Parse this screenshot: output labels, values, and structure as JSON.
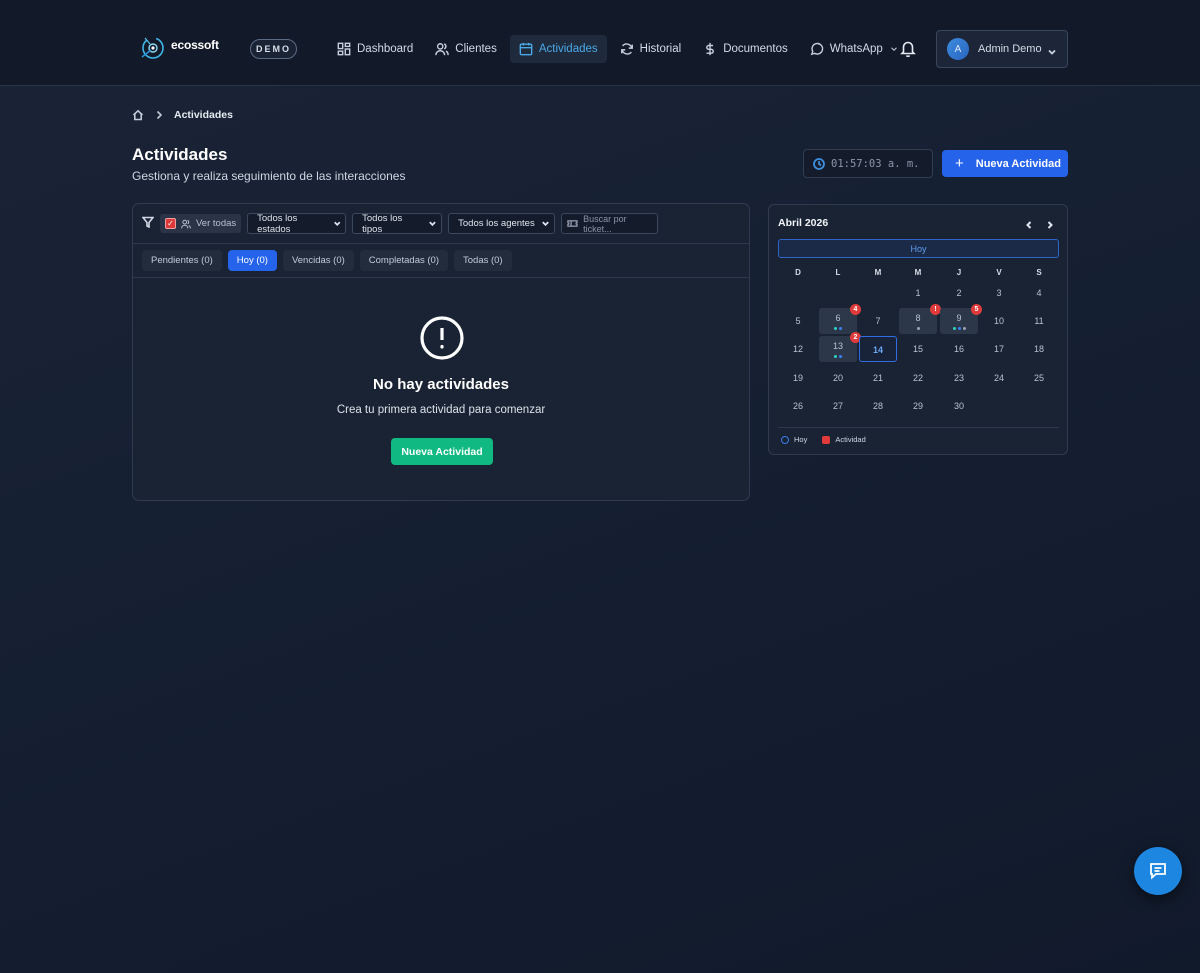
{
  "brand": {
    "logo_text": "ecossoft",
    "badge": "DEMO"
  },
  "nav": {
    "items": [
      {
        "label": "Dashboard",
        "icon": "dashboard-icon",
        "active": false
      },
      {
        "label": "Clientes",
        "icon": "users-icon",
        "active": false
      },
      {
        "label": "Actividades",
        "icon": "calendar-icon",
        "active": true
      },
      {
        "label": "Historial",
        "icon": "refresh-icon",
        "active": false
      },
      {
        "label": "Documentos",
        "icon": "dollar-icon",
        "active": false
      },
      {
        "label": "WhatsApp",
        "icon": "chat-bubble-icon",
        "active": false
      }
    ]
  },
  "user": {
    "avatar_letter": "A",
    "name": "Admin Demo"
  },
  "breadcrumb": {
    "current": "Actividades"
  },
  "page": {
    "title": "Actividades",
    "subtitle": "Gestiona y realiza seguimiento de las interacciones",
    "clock": "01:57:03 a. m.",
    "new_button": "Nueva Actividad"
  },
  "filters": {
    "ver_todas": "Ver todas",
    "ver_todas_checked": true,
    "estados": "Todos los estados",
    "tipos": "Todos los tipos",
    "agentes": "Todos los agentes",
    "ticket_placeholder": "Buscar por ticket..."
  },
  "tabs": [
    {
      "label": "Pendientes (0)",
      "active": false
    },
    {
      "label": "Hoy (0)",
      "active": true
    },
    {
      "label": "Vencidas (0)",
      "active": false
    },
    {
      "label": "Completadas (0)",
      "active": false
    },
    {
      "label": "Todas (0)",
      "active": false
    }
  ],
  "empty_state": {
    "title": "No hay actividades",
    "message": "Crea tu primera actividad para comenzar",
    "button": "Nueva Actividad"
  },
  "calendar": {
    "month_label": "Abril 2026",
    "today_button": "Hoy",
    "weekdays": [
      "D",
      "L",
      "M",
      "M",
      "J",
      "V",
      "S"
    ],
    "first_weekday_index": 3,
    "days_in_month": 30,
    "today": 14,
    "activity_days": {
      "6": {
        "badge": "4",
        "dots": [
          "#2dd4bf",
          "#3b82f6"
        ]
      },
      "8": {
        "badge": "!",
        "dots": [
          "#9aa4b4"
        ]
      },
      "9": {
        "badge": "5",
        "dots": [
          "#2dd4bf",
          "#3b82f6",
          "#9aa4b4"
        ]
      },
      "13": {
        "badge": "2",
        "dots": [
          "#2dd4bf",
          "#3b82f6"
        ]
      }
    },
    "legend": {
      "today": "Hoy",
      "activity": "Actividad"
    }
  },
  "colors": {
    "primary": "#2563eb",
    "success": "#10b981",
    "danger": "#e03b3b",
    "accent": "#4aa8e6"
  }
}
